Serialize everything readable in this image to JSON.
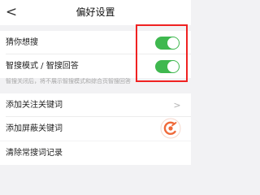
{
  "header": {
    "back_glyph": "<",
    "title": "偏好设置"
  },
  "settings": {
    "guess_search": {
      "label": "猜你想搜",
      "enabled": true
    },
    "smart_mode": {
      "label": "智搜模式 / 智搜回答",
      "enabled": true
    },
    "hint": "智搜关闭后，将不展示智搜模式和综合页智搜回答"
  },
  "keywords": {
    "add_follow": {
      "label": "添加关注关键词",
      "chevron_glyph": ">"
    },
    "add_block": {
      "label": "添加屏蔽关键词"
    },
    "clear_history": {
      "label": "清除常搜词记录"
    }
  },
  "colors": {
    "toggle_on": "#3fb84f",
    "highlight_box": "#f02222",
    "floating_icon": "#ef6a3a"
  },
  "icons": {
    "back": "chevron-left-icon",
    "forward": "chevron-right-icon",
    "floating": "floating-action-icon"
  }
}
